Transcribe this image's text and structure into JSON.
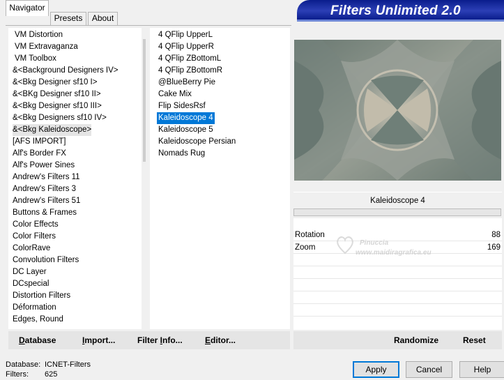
{
  "tabs": [
    {
      "label": "Navigator",
      "active": true
    },
    {
      "label": "Presets",
      "active": false
    },
    {
      "label": "About",
      "active": false
    }
  ],
  "banner": {
    "title": "Filters Unlimited 2.0"
  },
  "categories": [
    {
      "label": "VM Distortion",
      "indent": true
    },
    {
      "label": "VM Extravaganza",
      "indent": true
    },
    {
      "label": "VM Toolbox",
      "indent": true
    },
    {
      "label": "&<Background Designers IV>",
      "indent": false
    },
    {
      "label": "&<Bkg Designer sf10 I>",
      "indent": false
    },
    {
      "label": "&<BKg Designer sf10 II>",
      "indent": false
    },
    {
      "label": "&<Bkg Designer sf10 III>",
      "indent": false
    },
    {
      "label": "&<Bkg Designers sf10 IV>",
      "indent": false
    },
    {
      "label": "&<Bkg Kaleidoscope>",
      "indent": false,
      "selected": true
    },
    {
      "label": "[AFS IMPORT]",
      "indent": false
    },
    {
      "label": "Alf's Border FX",
      "indent": false
    },
    {
      "label": "Alf's Power Sines",
      "indent": false
    },
    {
      "label": "Andrew's Filters 11",
      "indent": false
    },
    {
      "label": "Andrew's Filters 3",
      "indent": false
    },
    {
      "label": "Andrew's Filters 51",
      "indent": false
    },
    {
      "label": "Buttons & Frames",
      "indent": false
    },
    {
      "label": "Color Effects",
      "indent": false
    },
    {
      "label": "Color Filters",
      "indent": false
    },
    {
      "label": "ColorRave",
      "indent": false
    },
    {
      "label": "Convolution Filters",
      "indent": false
    },
    {
      "label": "DC Layer",
      "indent": false
    },
    {
      "label": "DCspecial",
      "indent": false
    },
    {
      "label": "Distortion Filters",
      "indent": false
    },
    {
      "label": "Déformation",
      "indent": false
    },
    {
      "label": "Edges, Round",
      "indent": false
    }
  ],
  "filters": [
    {
      "label": "4 QFlip UpperL"
    },
    {
      "label": "4 QFlip UpperR"
    },
    {
      "label": "4 QFlip ZBottomL"
    },
    {
      "label": "4 QFlip ZBottomR"
    },
    {
      "label": "@BlueBerry Pie"
    },
    {
      "label": "Cake Mix"
    },
    {
      "label": "Flip SidesRsf"
    },
    {
      "label": "Kaleidoscope 4",
      "selected": true
    },
    {
      "label": "Kaleidoscope 5"
    },
    {
      "label": "Kaleidoscope Persian"
    },
    {
      "label": "Nomads Rug"
    }
  ],
  "selected_filter_name": "Kaleidoscope 4",
  "params": [
    {
      "label": "Rotation",
      "value": "88"
    },
    {
      "label": "Zoom",
      "value": "169"
    }
  ],
  "watermark": {
    "line1": "Pinuccia",
    "line2": "www.maidiragrafica.eu"
  },
  "left_toolbar": {
    "database": {
      "u": "D",
      "rest": "atabase"
    },
    "import": {
      "u": "I",
      "rest": "mport..."
    },
    "filter_info": {
      "pre": "Filter ",
      "u": "I",
      "rest": "nfo..."
    },
    "editor": {
      "u": "E",
      "rest": "ditor..."
    }
  },
  "right_toolbar": {
    "randomize": "Randomize",
    "reset": "Reset"
  },
  "status": {
    "database_label": "Database:",
    "database_value": "ICNET-Filters",
    "filters_label": "Filters:",
    "filters_value": "625"
  },
  "buttons": {
    "apply": "Apply",
    "cancel": "Cancel",
    "help": "Help"
  },
  "colors": {
    "selection": "#0078d7",
    "banner": "#0a1d8c",
    "preview_base": "#7d8a84"
  }
}
